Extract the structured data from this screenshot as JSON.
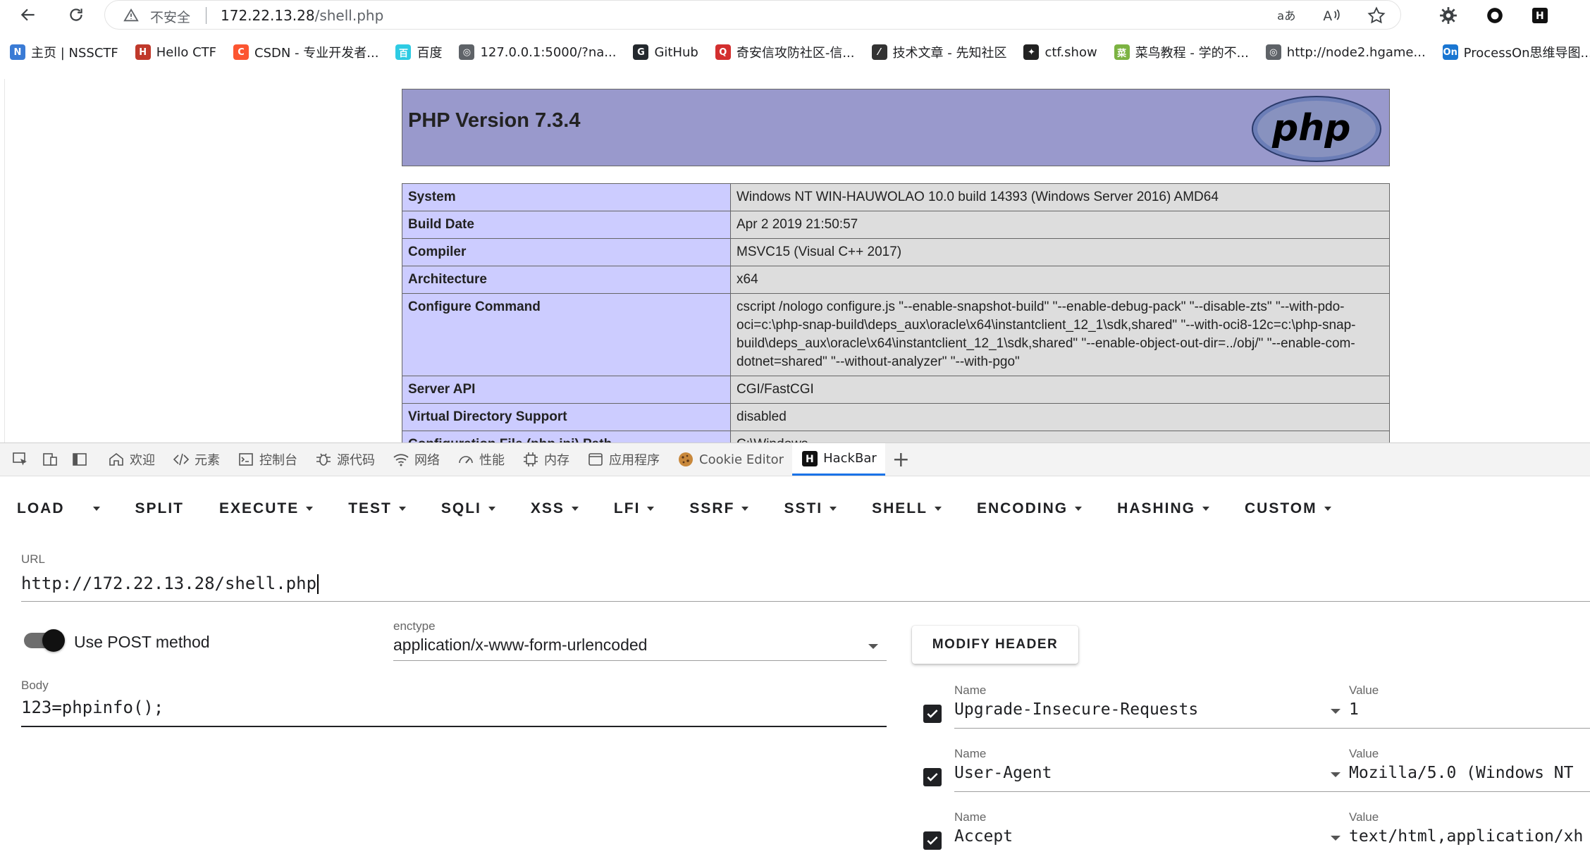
{
  "browser": {
    "insecure_label": "不安全",
    "url_host": "172.22.13.28",
    "url_path": "/shell.php"
  },
  "bookmarks": [
    {
      "label": "主页 | NSSCTF",
      "icon": "nssctf-icon",
      "color": "#3a7bd5",
      "glyph": "N"
    },
    {
      "label": "Hello CTF",
      "icon": "hellctf-icon",
      "color": "#c0392b",
      "glyph": "H"
    },
    {
      "label": "CSDN - 专业开发者...",
      "icon": "csdn-icon",
      "color": "#fc5531",
      "glyph": "C"
    },
    {
      "label": "百度",
      "icon": "baidu-icon",
      "color": "#2ecbe3",
      "glyph": "百"
    },
    {
      "label": "127.0.0.1:5000/?na...",
      "icon": "globe-icon",
      "color": "#5f6368",
      "glyph": "◎"
    },
    {
      "label": "GitHub",
      "icon": "github-icon",
      "color": "#24292e",
      "glyph": "G"
    },
    {
      "label": "奇安信攻防社区-信...",
      "icon": "qianxin-icon",
      "color": "#d32f2f",
      "glyph": "Q"
    },
    {
      "label": "技术文章 - 先知社区",
      "icon": "xianzhi-icon",
      "color": "#333333",
      "glyph": "⁄"
    },
    {
      "label": "ctf.show",
      "icon": "ctfshow-icon",
      "color": "#222222",
      "glyph": "✦"
    },
    {
      "label": "菜鸟教程 - 学的不...",
      "icon": "runoob-icon",
      "color": "#7cb342",
      "glyph": "菜"
    },
    {
      "label": "http://node2.hgame...",
      "icon": "globe-icon",
      "color": "#5f6368",
      "glyph": "◎"
    },
    {
      "label": "ProcessOn思维导图...",
      "icon": "processon-icon",
      "color": "#1976d2",
      "glyph": "On"
    }
  ],
  "phpinfo": {
    "title": "PHP Version 7.3.4",
    "logo_text": "php",
    "rows": [
      {
        "key": "System",
        "value": "Windows NT WIN-HAUWOLAO 10.0 build 14393 (Windows Server 2016) AMD64"
      },
      {
        "key": "Build Date",
        "value": "Apr 2 2019 21:50:57"
      },
      {
        "key": "Compiler",
        "value": "MSVC15 (Visual C++ 2017)"
      },
      {
        "key": "Architecture",
        "value": "x64"
      },
      {
        "key": "Configure Command",
        "value": "cscript /nologo configure.js \"--enable-snapshot-build\" \"--enable-debug-pack\" \"--disable-zts\" \"--with-pdo-oci=c:\\php-snap-build\\deps_aux\\oracle\\x64\\instantclient_12_1\\sdk,shared\" \"--with-oci8-12c=c:\\php-snap-build\\deps_aux\\oracle\\x64\\instantclient_12_1\\sdk,shared\" \"--enable-object-out-dir=../obj/\" \"--enable-com-dotnet=shared\" \"--without-analyzer\" \"--with-pgo\""
      },
      {
        "key": "Server API",
        "value": "CGI/FastCGI"
      },
      {
        "key": "Virtual Directory Support",
        "value": "disabled"
      },
      {
        "key": "Configuration File (php.ini) Path",
        "value": "C:\\Windows"
      }
    ]
  },
  "devtools": {
    "tabs": [
      {
        "label": "欢迎",
        "icon": "home-icon"
      },
      {
        "label": "元素",
        "icon": "code-icon"
      },
      {
        "label": "控制台",
        "icon": "console-icon"
      },
      {
        "label": "源代码",
        "icon": "bug-icon"
      },
      {
        "label": "网络",
        "icon": "wifi-icon"
      },
      {
        "label": "性能",
        "icon": "performance-icon"
      },
      {
        "label": "内存",
        "icon": "memory-icon"
      },
      {
        "label": "应用程序",
        "icon": "application-icon"
      },
      {
        "label": "Cookie Editor",
        "icon": "cookie-icon"
      },
      {
        "label": "HackBar",
        "icon": "hackbar-icon"
      }
    ],
    "active_tab": "HackBar"
  },
  "hackbar": {
    "menu": {
      "load": "LOAD",
      "items": [
        "SPLIT",
        "EXECUTE",
        "TEST",
        "SQLI",
        "XSS",
        "LFI",
        "SSRF",
        "SSTI",
        "SHELL",
        "ENCODING",
        "HASHING",
        "CUSTOM"
      ]
    },
    "url_label": "URL",
    "url_value": "http://172.22.13.28/shell.php",
    "post_label": "Use POST method",
    "post_enabled": true,
    "enctype_label": "enctype",
    "enctype_value": "application/x-www-form-urlencoded",
    "modify_header_label": "MODIFY HEADER",
    "body_label": "Body",
    "body_value": "123=phpinfo();",
    "headers": [
      {
        "name_label": "Name",
        "name": "Upgrade-Insecure-Requests",
        "value_label": "Value",
        "value": "1",
        "checked": true
      },
      {
        "name_label": "Name",
        "name": "User-Agent",
        "value_label": "Value",
        "value": "Mozilla/5.0 (Windows NT",
        "checked": true
      },
      {
        "name_label": "Name",
        "name": "Accept",
        "value_label": "Value",
        "value": "text/html,application/xh",
        "checked": true
      }
    ]
  }
}
